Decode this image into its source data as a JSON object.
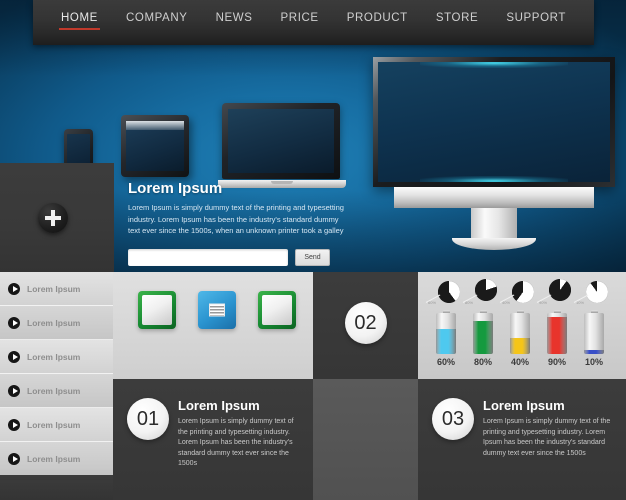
{
  "nav": {
    "items": [
      {
        "label": "HOME",
        "active": true
      },
      {
        "label": "COMPANY",
        "active": false
      },
      {
        "label": "NEWS",
        "active": false
      },
      {
        "label": "PRICE",
        "active": false
      },
      {
        "label": "PRODUCT",
        "active": false
      },
      {
        "label": "STORE",
        "active": false
      },
      {
        "label": "SUPPORT",
        "active": false
      }
    ],
    "active_underline_color": "#c0392b"
  },
  "promo": {
    "title": "Lorem Ipsum",
    "text": "Lorem Ipsum is simply dummy text of the printing and typesetting industry. Lorem Ipsum has been the industry's standard dummy text ever since the 1500s, when an unknown printer took a galley",
    "input_value": "",
    "input_placeholder": "",
    "send_label": "Send",
    "plus_icon": "plus-icon"
  },
  "sidebar": {
    "items": [
      {
        "label": "Lorem Ipsum",
        "icon": "play-icon"
      },
      {
        "label": "Lorem Ipsum",
        "icon": "play-icon"
      },
      {
        "label": "Lorem Ipsum",
        "icon": "play-icon"
      },
      {
        "label": "Lorem Ipsum",
        "icon": "play-icon"
      },
      {
        "label": "Lorem Ipsum",
        "icon": "play-icon"
      },
      {
        "label": "Lorem Ipsum",
        "icon": "play-icon"
      }
    ]
  },
  "icon_boxes": [
    {
      "name": "app-icon-green-1",
      "color": "#178a32",
      "style": "green"
    },
    {
      "name": "app-icon-blue",
      "color": "#2a93cf",
      "style": "blue"
    },
    {
      "name": "app-icon-green-2",
      "color": "#178a32",
      "style": "green"
    }
  ],
  "badges": {
    "step_two": "02",
    "step_one": "01",
    "step_three": "03"
  },
  "blocks": [
    {
      "number": "01",
      "title": "Lorem Ipsum",
      "text": "Lorem Ipsum is simply dummy text of the printing and typesetting industry. Lorem Ipsum has been the industry's standard dummy text ever since the 1500s"
    },
    {
      "number": "03",
      "title": "Lorem Ipsum",
      "text": "Lorem Ipsum is simply dummy text of the printing and typesetting industry. Lorem Ipsum has been the industry's standard dummy text ever since the 1500s"
    }
  ],
  "chart_data": [
    {
      "type": "bar",
      "title": "",
      "xlabel": "",
      "ylabel": "",
      "ylim": [
        0,
        100
      ],
      "categories": [
        "60%",
        "80%",
        "40%",
        "90%",
        "10%"
      ],
      "values": [
        60,
        80,
        40,
        90,
        10
      ],
      "colors": [
        "#4ec9ef",
        "#159a3f",
        "#f5c518",
        "#e8342c",
        "#3a50c8"
      ],
      "legend": "none",
      "grid": false,
      "note": "battery-style vertical fill bars with percentage labels"
    },
    {
      "type": "pie",
      "title": "",
      "legend": "none",
      "grid": false,
      "slices": [
        {
          "label": "60%",
          "value": 60
        },
        {
          "label": "80%",
          "value": 80
        },
        {
          "label": "40%",
          "value": 40
        },
        {
          "label": "90%",
          "value": 90
        },
        {
          "label": "10%",
          "value": 10
        }
      ],
      "colors": {
        "filled": "#1a1a1a",
        "empty": "#ffffff"
      },
      "note": "five small two-tone pie markers with leader lines above the bars"
    }
  ],
  "devices": [
    {
      "name": "smartphone",
      "screen_color": "#0e2438"
    },
    {
      "name": "tablet",
      "screen_color": "#112a40"
    },
    {
      "name": "laptop",
      "screen_color": "#122c42"
    },
    {
      "name": "monitor",
      "screen_color": "#0e3350",
      "glow_color": "#49e1f5"
    }
  ]
}
